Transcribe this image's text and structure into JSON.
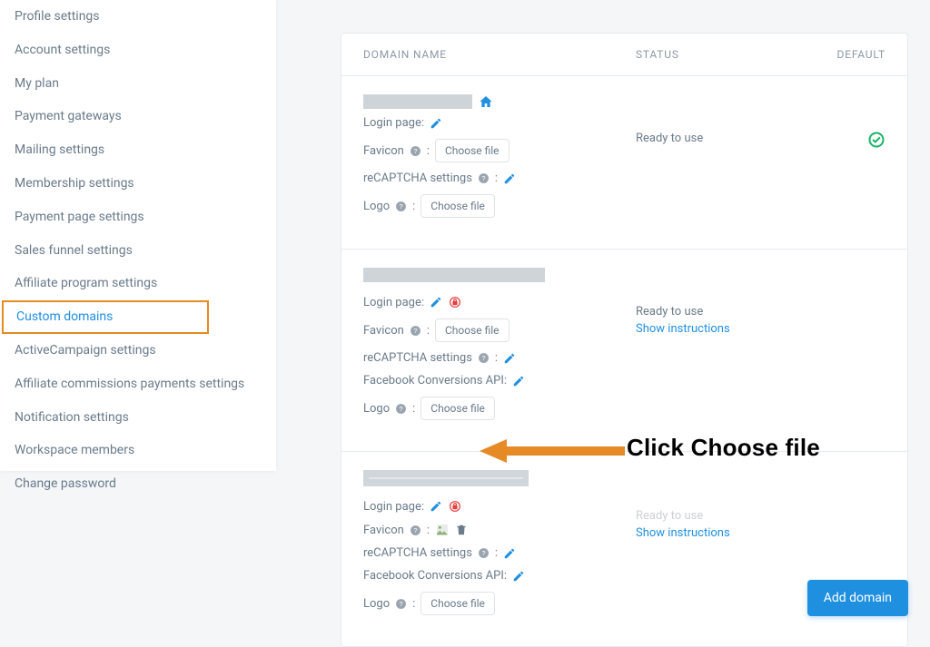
{
  "sidebar": {
    "items": [
      {
        "label": "Profile settings"
      },
      {
        "label": "Account settings"
      },
      {
        "label": "My plan"
      },
      {
        "label": "Payment gateways"
      },
      {
        "label": "Mailing settings"
      },
      {
        "label": "Membership settings"
      },
      {
        "label": "Payment page settings"
      },
      {
        "label": "Sales funnel settings"
      },
      {
        "label": "Affiliate program settings"
      },
      {
        "label": "Custom domains"
      },
      {
        "label": "ActiveCampaign settings"
      },
      {
        "label": "Affiliate commissions payments settings"
      },
      {
        "label": "Notification settings"
      },
      {
        "label": "Workspace members"
      },
      {
        "label": "Change password"
      }
    ],
    "active_index": 9
  },
  "table": {
    "headers": {
      "name": "DOMAIN NAME",
      "status": "STATUS",
      "default": "DEFAULT"
    }
  },
  "settings_labels": {
    "login_page": "Login page:",
    "favicon": "Favicon",
    "recaptcha": "reCAPTCHA settings",
    "fb_api": "Facebook Conversions API:",
    "logo": "Logo",
    "choose_file": "Choose file"
  },
  "domains": [
    {
      "status": "Ready to use",
      "show_instructions": false,
      "default": true,
      "has_fb_api": false,
      "favicon_uploaded": false,
      "lock": false
    },
    {
      "status": "Ready to use",
      "show_instructions": true,
      "default": false,
      "has_fb_api": true,
      "favicon_uploaded": false,
      "lock": true
    },
    {
      "status": "Ready to use",
      "show_instructions": true,
      "default": false,
      "has_fb_api": true,
      "favicon_uploaded": true,
      "lock": true
    }
  ],
  "instructions_label": "Show instructions",
  "add_domain_label": "Add domain",
  "annotation": "Click Choose file",
  "colors": {
    "accent": "#1f8fe0",
    "orange": "#e58a24",
    "green": "#18b566",
    "red": "#e63c3c"
  }
}
